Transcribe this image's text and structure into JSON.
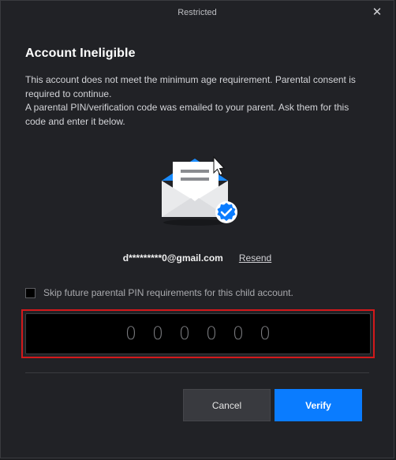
{
  "window": {
    "title": "Restricted",
    "close_icon": "close-icon"
  },
  "dialog": {
    "heading": "Account Ineligible",
    "description_line1": "This account does not meet the minimum age requirement. Parental consent is required to continue.",
    "description_line2": "A parental PIN/verification code was emailed to your parent. Ask them for this code and enter it below.",
    "illustration_icon": "envelope-check-icon",
    "email": "d*********0@gmail.com",
    "resend_label": "Resend",
    "skip_label": "Skip future parental PIN requirements for this child account.",
    "skip_checked": false,
    "pin_placeholder": [
      "0",
      "0",
      "0",
      "0",
      "0",
      "0"
    ],
    "cancel_label": "Cancel",
    "verify_label": "Verify"
  },
  "colors": {
    "accent": "#0a7cff",
    "highlight_border": "#d3191b",
    "background": "#212226"
  }
}
